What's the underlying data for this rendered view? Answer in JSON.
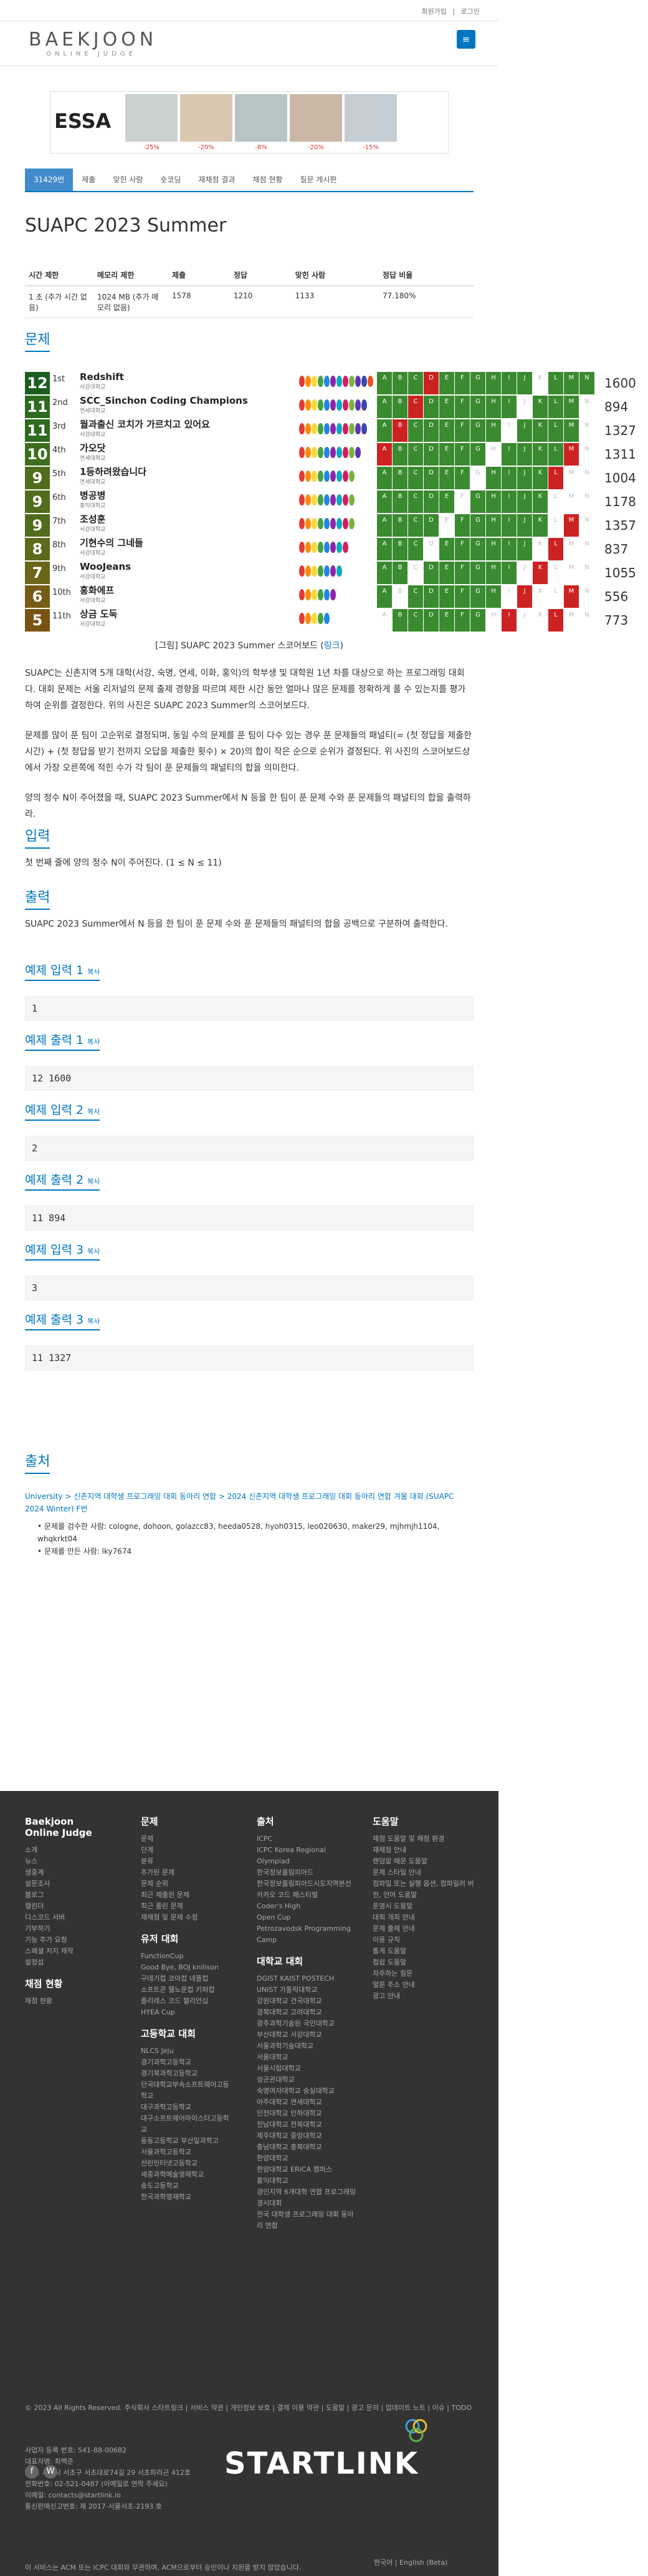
{
  "topbar": {
    "register": "회원가입",
    "login": "로그인"
  },
  "header": {
    "logo_top": "BAEKJOON",
    "logo_bottom": "ONLINE JUDGE",
    "menu_icon": "menu-icon"
  },
  "ad": {
    "brand": "ESSA",
    "discounts": [
      "-25%",
      "-20%",
      "-8%",
      "-20%",
      "-15%"
    ]
  },
  "tabs": [
    "31429번",
    "제출",
    "맞힌 사람",
    "숏코딩",
    "재채점 결과",
    "채점 현황",
    "질문 게시판"
  ],
  "problem": {
    "title": "SUAPC 2023 Summer",
    "info_headers": [
      "시간 제한",
      "메모리 제한",
      "제출",
      "정답",
      "맞힌 사람",
      "정답 비율"
    ],
    "info_values": [
      "1 초 (추가 시간 없음)",
      "1024 MB (추가 메모리 없음)",
      "1578",
      "1210",
      "1133",
      "77.180%"
    ]
  },
  "sections": {
    "problem": "문제",
    "input": "입력",
    "output": "출력",
    "source": "출처"
  },
  "scoreboard": [
    {
      "rank_num": "12",
      "place": "1st",
      "team": "Redshift",
      "school": "서강대학교",
      "score": "1600",
      "color": "#1b5e20"
    },
    {
      "rank_num": "11",
      "place": "2nd",
      "team": "SCC_Sinchon Coding Champions",
      "school": "연세대학교",
      "score": "894",
      "color": "#2e6b1f"
    },
    {
      "rank_num": "11",
      "place": "3rd",
      "team": "월과출신 코치가 가르치고 있어요",
      "school": "서강대학교",
      "score": "1327",
      "color": "#2e6b1f"
    },
    {
      "rank_num": "10",
      "place": "4th",
      "team": "가오닷",
      "school": "연세대학교",
      "score": "1311",
      "color": "#3d6e1e"
    },
    {
      "rank_num": "9",
      "place": "5th",
      "team": "1등하려왔습니다",
      "school": "연세대학교",
      "score": "1004",
      "color": "#4f6d1c"
    },
    {
      "rank_num": "9",
      "place": "6th",
      "team": "병공병",
      "school": "홍익대학교",
      "score": "1178",
      "color": "#4f6d1c"
    },
    {
      "rank_num": "9",
      "place": "7th",
      "team": "조성훈",
      "school": "서강대학교",
      "score": "1357",
      "color": "#4f6d1c"
    },
    {
      "rank_num": "8",
      "place": "8th",
      "team": "기현수의 그네들",
      "school": "서강대학교",
      "score": "837",
      "color": "#5d6a1a"
    },
    {
      "rank_num": "7",
      "place": "9th",
      "team": "WooJeans",
      "school": "서강대학교",
      "score": "1055",
      "color": "#6b6618"
    },
    {
      "rank_num": "6",
      "place": "10th",
      "team": "홍화에프",
      "school": "서강대학교",
      "score": "556",
      "color": "#775c16"
    },
    {
      "rank_num": "5",
      "place": "11th",
      "team": "상금 도둑",
      "school": "서강대학교",
      "score": "773",
      "color": "#7a5314"
    }
  ],
  "columns": [
    "A",
    "B",
    "C",
    "D",
    "E",
    "F",
    "G",
    "H",
    "I",
    "J",
    "K",
    "L",
    "M",
    "N"
  ],
  "caption": {
    "text": "[그림] SUAPC 2023 Summer 스코어보드 (",
    "link": "링크",
    "close": ")"
  },
  "body": {
    "p1": "SUAPC는 신촌지역 5개 대학(서강, 숙명, 연세, 이화, 홍익)의 학부생 및 대학원 1년 차를 대상으로 하는 프로그래밍 대회다. 대회 문제는 서울 리저널의 문제 출제 경향을 따르며 제한 시간 동안 얼마나 많은 문제를 정확하게 풀 수 있는지를 평가하여 순위를 결정한다. 위의 사진은 SUAPC 2023 Summer의 스코어보드다.",
    "p2": "문제를 많이 푼 팀이 고순위로 결정되며, 동일 수의 문제를 푼 팀이 다수 있는 경우 푼 문제들의 패널티(= (첫 정답을 제출한 시간) + (첫 정답을 받기 전까지 오답을 제출한 횟수) × 20)의 합이 작은 순으로 순위가 결정된다. 위 사진의 스코어보드상에서 가장 오른쪽에 적힌 수가 각 팀이 푼 문제들의 패널티의 합을 의미한다.",
    "p3": "양의 정수 N이 주어졌을 때, SUAPC 2023 Summer에서 N 등을 한 팀이 푼 문제 수와 푼 문제들의 패널티의 합을 출력하라.",
    "input": "첫 번째 줄에 양의 정수 N이 주어진다. (1 ≤ N ≤ 11)",
    "output": "SUAPC 2023 Summer에서 N 등을 한 팀이 푼 문제 수와 푼 문제들의 패널티의 합을 공백으로 구분하여 출력한다."
  },
  "examples": [
    {
      "in_title": "예제 입력 1",
      "in": "1",
      "out_title": "예제 출력 1",
      "out": "12 1600"
    },
    {
      "in_title": "예제 입력 2",
      "in": "2",
      "out_title": "예제 출력 2",
      "out": "11 894"
    },
    {
      "in_title": "예제 입력 3",
      "in": "3",
      "out_title": "예제 출력 3",
      "out": "11 1327"
    }
  ],
  "copy_label": "복사",
  "source": {
    "line": "University > 신촌지역 대학생 프로그래밍 대회 동아리 연합 > 2024 신촌지역 대학생 프로그래밍 대회 동아리 연합 겨울 대회 (SUAPC 2024 Winter) F번",
    "b1": "문제를 검수한 사람: cologne, dohoon, golazcc83, heeda0528, hyoh0315, leo020630, maker29, mjhmjh1104, whqkrkt04",
    "b2": "문제를 만든 사람: lky7674"
  },
  "footer": {
    "col1_title": "Baekjoon Online Judge",
    "col1": [
      "소개",
      "뉴스",
      "생중계",
      "설문조사",
      "블로그",
      "캘린더",
      "디스코드 서버",
      "기부하기",
      "기능 추가 요청",
      "스페셜 저지 제작",
      "설정섭"
    ],
    "col1b_title": "채점 현황",
    "col1b": [
      "채점 현황"
    ],
    "col2_title": "문제",
    "col2": [
      "문제",
      "단계",
      "분류",
      "추가된 문제",
      "문제 순위",
      "최근 제출된 문제",
      "최근 풀린 문제",
      "재채점 및 문제 수정"
    ],
    "col2b_title": "유저 대회",
    "col2b": [
      "FunctionCup",
      "Good Bye, BOJ knilison",
      "구데기컵 코아컵 네플컵",
      "소프트콘 웰노운컵 키퍼컵",
      "플리레스 코드 챌리언십",
      "HYEA Cup"
    ],
    "col2c_title": "고등학교 대회",
    "col2c": [
      "NLCS Jeju",
      "경기과학고등학교",
      "경기북과학고등학교",
      "단국대학교부속소프트웨어고등학교",
      "대구과학고등학교",
      "대구소프트웨어마이스터고등학교",
      "동동고등학교 부산일과학고",
      "서울과학고등학교",
      "선린인터넷고등학교",
      "세종과학예술영재학교",
      "송도고등학교",
      "한국과학영재학교"
    ],
    "col3_title": "출처",
    "col3": [
      "ICPC",
      "ICPC Korea Regional",
      "Olympiad",
      "한국정보올림피아드",
      "한국정보올림피아드시도지역본선",
      "카카오 코드 페스티벌",
      "Coder's High",
      "Open Cup",
      "Petrozavodsk Programming Camp"
    ],
    "col3b_title": "대학교 대회",
    "col3b": [
      "DGIST KAIST POSTECH",
      "UNIST 가톨릭대학교",
      "강원대학교 건국대학교",
      "경북대학교 고려대학교",
      "광주과학기술원 국민대학교",
      "부산대학교 서강대학교",
      "서울과학기술대학교",
      "서울대학교",
      "서울시립대학교",
      "성균관대학교",
      "숙명여자대학교 숭실대학교",
      "아주대학교 연세대학교",
      "인천대학교 인하대학교",
      "전남대학교 전북대학교",
      "제주대학교 중앙대학교",
      "충남대학교 충북대학교",
      "한양대학교",
      "한양대학교 ERICA 캠퍼스",
      "홍익대학교",
      "경인지역 6개대학 연합 프로그래밍 경시대회",
      "전국 대학생 프로그래밍 대회 동아리 연합"
    ],
    "col4_title": "도움말",
    "col4": [
      "채점 도움말 및 채점 환경",
      "재채점 안내",
      "랜덤말 때문 도움말",
      "문제 스타일 안내",
      "컴파일 또는 실행 옵션, 컴파일러 버전, 언어 도움말",
      "운영시 도움말",
      "대회 개최 안내",
      "문제 출제 안내",
      "이용 규칙",
      "톱게 도움말",
      "접쉽 도움말",
      "자주하는 질문",
      "얼룬 주소 안내",
      "광고 안내"
    ],
    "bottom": [
      "© 2023 All Rights Reserved. 주식회사 스타트링크 | 서비스 약관 | 개인정보 보호 | 결제 이용 약관 | 도움말 | 광고 문의 | 업데이트 노트 | 이슈 | TODO",
      "사업자 등록 번호: 541-88-00682",
      "대표자명: 최백준",
      "주소: 서울시 서초구 서초대로74길 29 서초파라곤 412호",
      "전화번호: 02-521-0487 (이메일로 연락 주세요)",
      "이메일: contacts@startlink.io",
      "통신판매신고번호: 제 2017-서울서초-2193 호",
      "이 서비스는 ACM 또는 ICPC 대회와 무관하며, ACM으로부터 승인이나 지원을 받지 않았습니다."
    ],
    "lang": "한국어 | English (Beta)",
    "startlink": "STARTLINK"
  }
}
